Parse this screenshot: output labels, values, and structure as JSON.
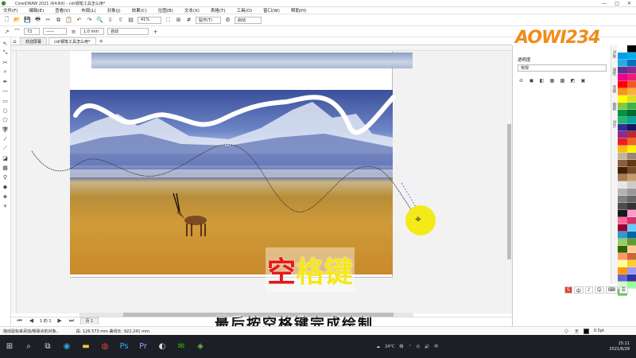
{
  "window": {
    "title": "CorelDRAW 2021 (64-Bit) - cdr钢笔工具怎么用*",
    "controls": [
      "—",
      "□",
      "✕"
    ]
  },
  "menu": [
    "文件(F)",
    "编辑(E)",
    "查看(V)",
    "布局(L)",
    "对象(J)",
    "效果(C)",
    "位图(B)",
    "文本(X)",
    "表格(T)",
    "工具(O)",
    "窗口(W)",
    "帮助(H)"
  ],
  "toolbar1": {
    "zoom": "41%",
    "snap": "贴齐(T)",
    "launch": "启动"
  },
  "toolbar2": {
    "angle": "72",
    "line_style": "——",
    "width": "1.0 mm",
    "wrap": "自动"
  },
  "tabs": {
    "welcome": "欢迎屏幕",
    "document": "cdr钢笔工具怎么用*"
  },
  "page_nav": {
    "counter": "1 的 1",
    "page_label": "页 1"
  },
  "panel": {
    "title": "透明度",
    "preset": "常规",
    "logo": "AOWI234"
  },
  "sidetabs": [
    "对象",
    "属性",
    "变换",
    "图框",
    "对齐"
  ],
  "overlay": {
    "char1": "空",
    "char2": "格键"
  },
  "subtitle": "最后按空格键完成绘制",
  "ime": [
    "S",
    "中",
    "♪",
    "☺",
    "⌨",
    "☰"
  ],
  "status": {
    "hint": "拖动鼠标来添加/移除点的对象。",
    "segment": "段: 126.573 mm 曲线长: 922.241 mm",
    "fill_label": "无",
    "outline": "0.5pt"
  },
  "taskbar": {
    "weather": "24°C",
    "weather_text": "晴",
    "time": "15:11",
    "date": "2021/8/28",
    "ime": "中"
  },
  "palette_colors": [
    "#ffffff",
    "#000000",
    "#00a0e9",
    "#00aeef",
    "#29abe2",
    "#0071bc",
    "#662d91",
    "#92278f",
    "#ec008c",
    "#ed1e79",
    "#ff0000",
    "#f15a24",
    "#f7931e",
    "#fbb03b",
    "#ffff00",
    "#d9e021",
    "#8cc63f",
    "#39b54a",
    "#009245",
    "#006837",
    "#22b573",
    "#00a99d",
    "#2e3192",
    "#1b1464",
    "#93278f",
    "#c1272d",
    "#ed1c24",
    "#f26522",
    "#fdb913",
    "#fff200",
    "#c2b59b",
    "#998675",
    "#8b5e3c",
    "#603813",
    "#42210b",
    "#754c24",
    "#a67c52",
    "#c69c6d",
    "#e6e6e6",
    "#cccccc",
    "#b3b3b3",
    "#999999",
    "#808080",
    "#666666",
    "#4d4d4d",
    "#333333",
    "#1a1a1a",
    "#ff99cc",
    "#ff6699",
    "#cc3366",
    "#990033",
    "#66ccff",
    "#3399cc",
    "#006699",
    "#99cc66",
    "#669933",
    "#336600",
    "#ffcc99",
    "#ff9966",
    "#cc6633",
    "#ffff99",
    "#ffcc33",
    "#ff9900",
    "#9999ff",
    "#6666cc",
    "#333399",
    "#ccffcc",
    "#99ff99",
    "#66cc66"
  ]
}
